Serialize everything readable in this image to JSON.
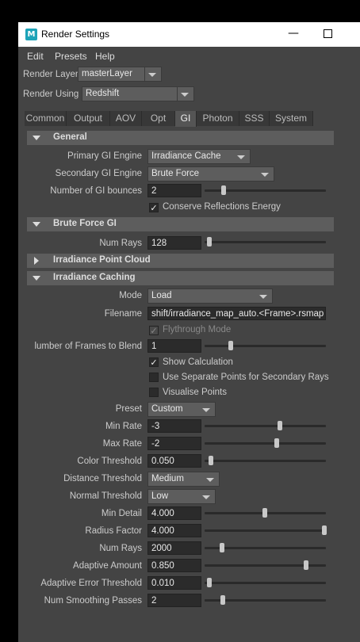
{
  "window": {
    "title": "Render Settings",
    "logo": "M"
  },
  "menubar": [
    "Edit",
    "Presets",
    "Help"
  ],
  "render_layer": {
    "label": "Render Layer",
    "value": "masterLayer"
  },
  "render_using": {
    "label": "Render Using",
    "value": "Redshift"
  },
  "tabs": [
    "Common",
    "Output",
    "AOV",
    "Opt",
    "GI",
    "Photon",
    "SSS",
    "System"
  ],
  "active_tab": "GI",
  "general": {
    "title": "General",
    "primary_label": "Primary GI Engine",
    "primary_value": "Irradiance Cache",
    "secondary_label": "Secondary GI Engine",
    "secondary_value": "Brute Force",
    "bounces_label": "Number of GI bounces",
    "bounces_value": "2",
    "conserve_label": "Conserve Reflections Energy"
  },
  "brute_force": {
    "title": "Brute Force GI",
    "numrays_label": "Num Rays",
    "numrays_value": "128"
  },
  "irr_point_cloud": {
    "title": "Irradiance Point Cloud"
  },
  "irr_caching": {
    "title": "Irradiance Caching",
    "mode_label": "Mode",
    "mode_value": "Load",
    "filename_label": "Filename",
    "filename_value": "shift/irradiance_map_auto.<Frame>.rsmap",
    "flythrough_label": "Flythrough Mode",
    "frames_label": "lumber of Frames to Blend",
    "frames_value": "1",
    "show_calc_label": "Show Calculation",
    "separate_points_label": "Use Separate Points for Secondary Rays",
    "visualise_label": "Visualise Points",
    "preset_label": "Preset",
    "preset_value": "Custom",
    "min_rate_label": "Min Rate",
    "min_rate_value": "-3",
    "max_rate_label": "Max Rate",
    "max_rate_value": "-2",
    "color_thr_label": "Color Threshold",
    "color_thr_value": "0.050",
    "dist_thr_label": "Distance Threshold",
    "dist_thr_value": "Medium",
    "normal_thr_label": "Normal Threshold",
    "normal_thr_value": "Low",
    "min_detail_label": "Min Detail",
    "min_detail_value": "4.000",
    "radius_label": "Radius Factor",
    "radius_value": "4.000",
    "numrays_label": "Num Rays",
    "numrays_value": "2000",
    "adaptive_amount_label": "Adaptive Amount",
    "adaptive_amount_value": "0.850",
    "adaptive_err_label": "Adaptive Error Threshold",
    "adaptive_err_value": "0.010",
    "smoothing_label": "Num Smoothing Passes",
    "smoothing_value": "2"
  }
}
